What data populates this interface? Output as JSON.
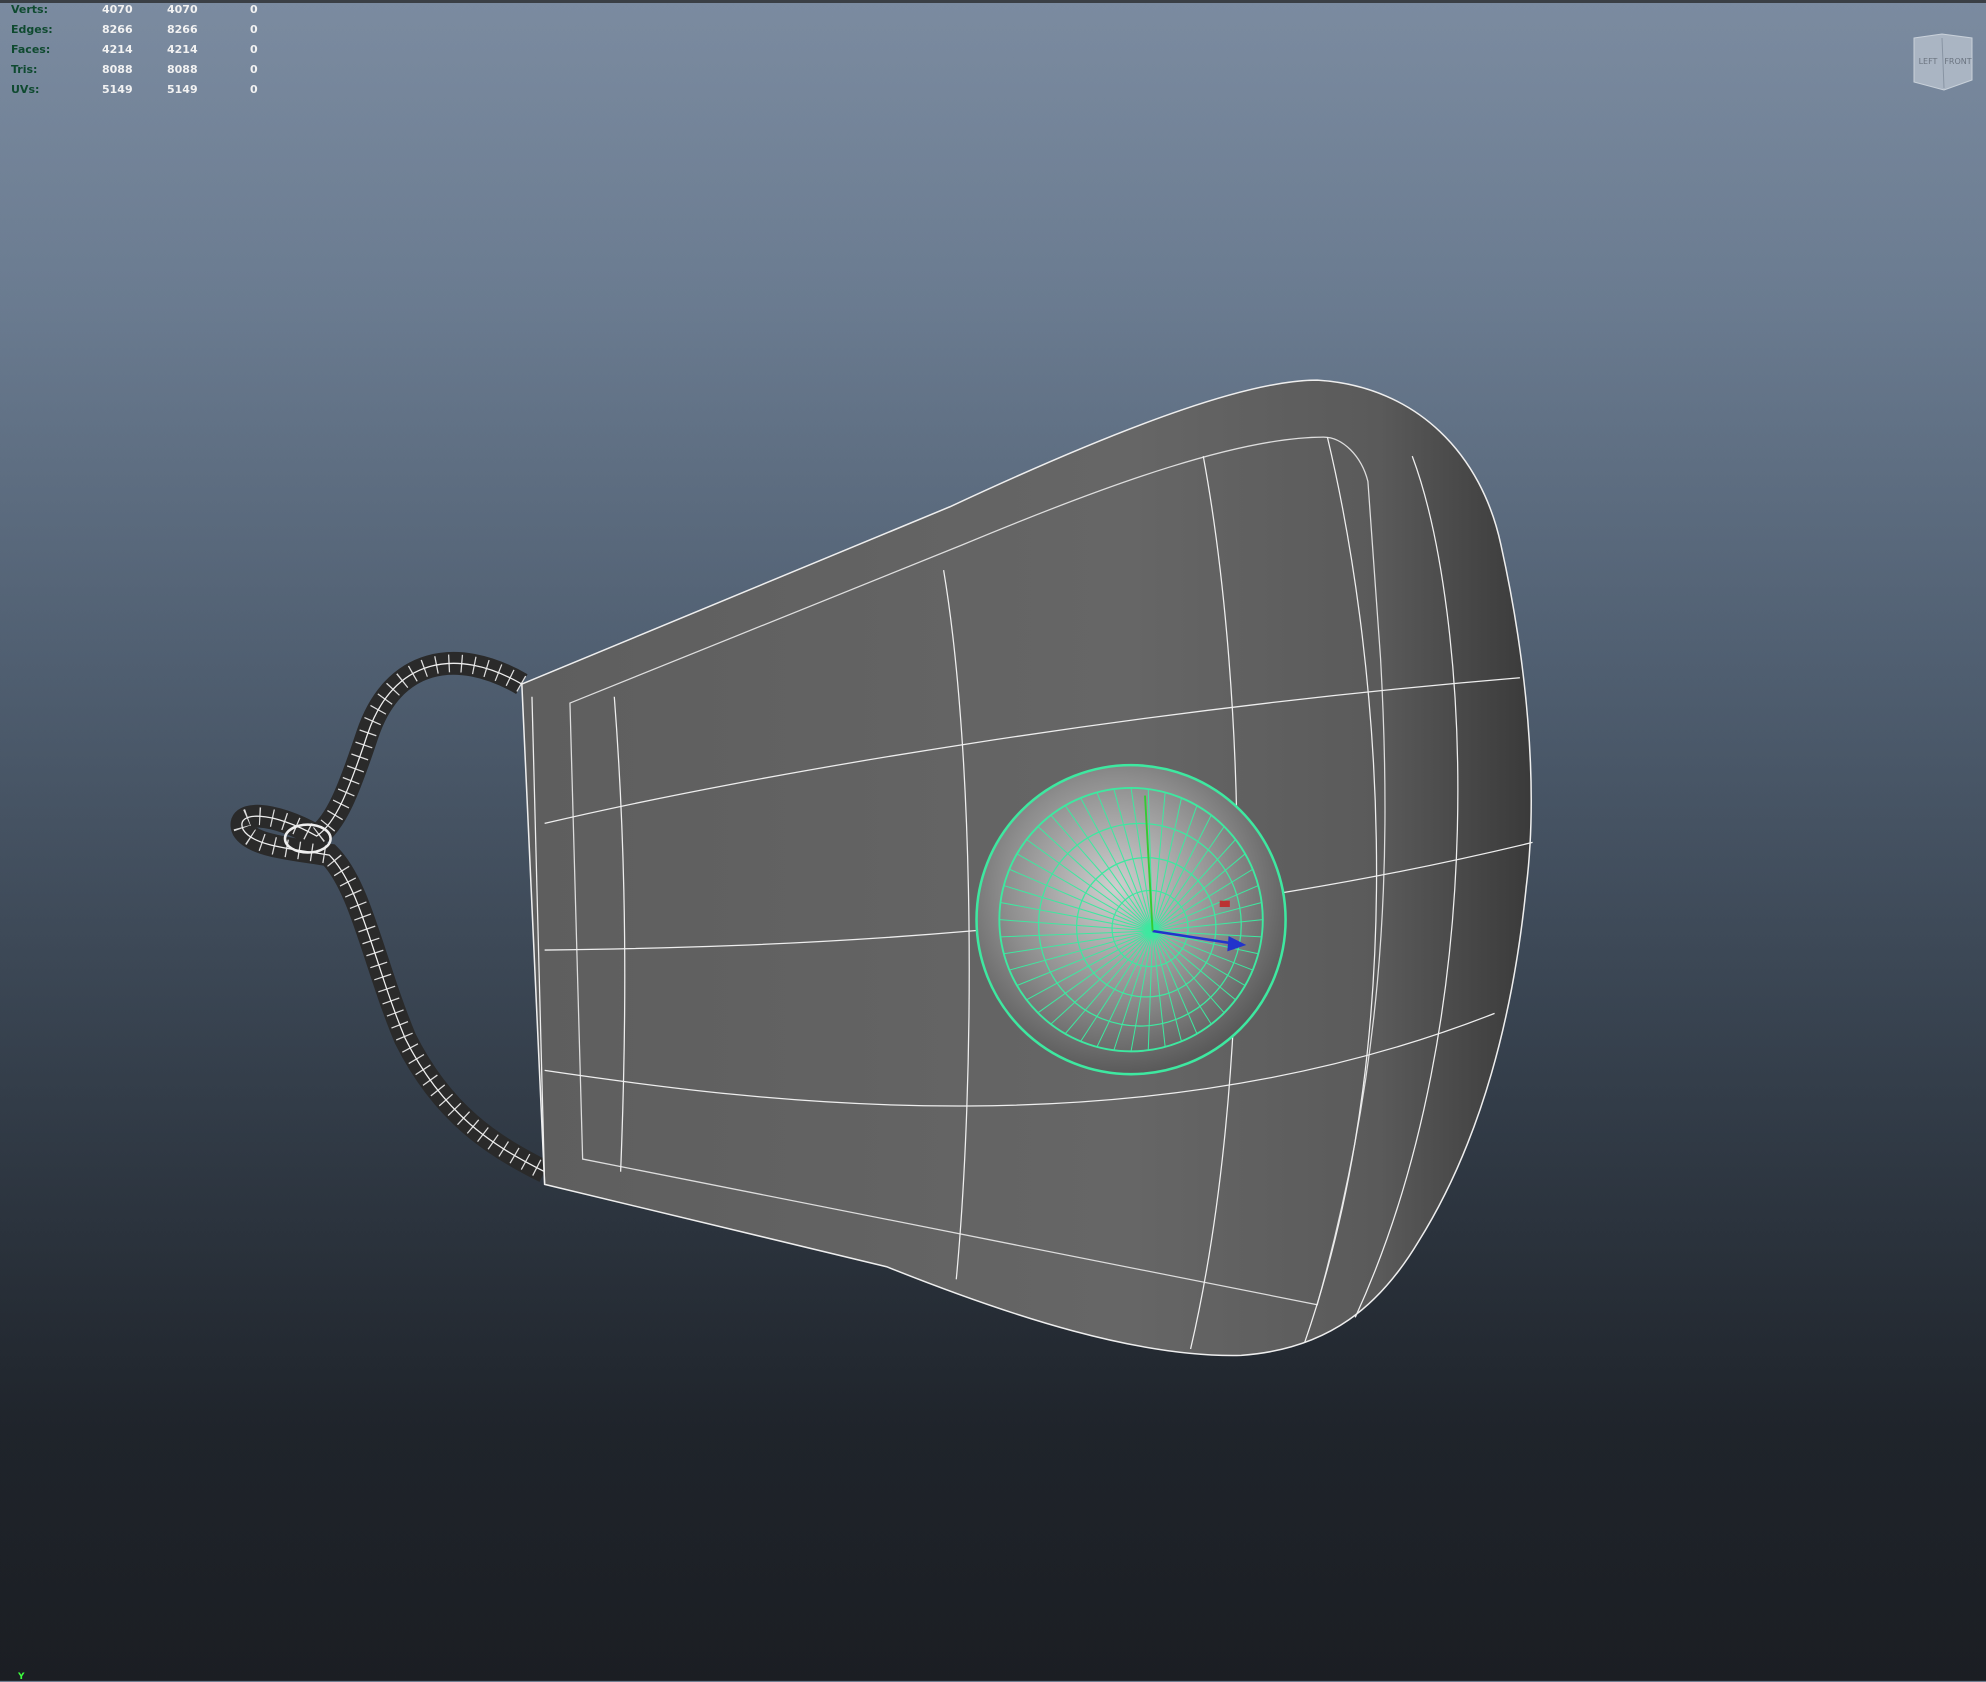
{
  "viewport": {
    "stats": [
      {
        "label": "Verts:",
        "values": [
          "4070",
          "4070",
          "0"
        ]
      },
      {
        "label": "Edges:",
        "values": [
          "8266",
          "8266",
          "0"
        ]
      },
      {
        "label": "Faces:",
        "values": [
          "4214",
          "4214",
          "0"
        ]
      },
      {
        "label": "Tris:",
        "values": [
          "8088",
          "8088",
          "0"
        ]
      },
      {
        "label": "UVs:",
        "values": [
          "5149",
          "5149",
          "0"
        ]
      }
    ],
    "view_cube": {
      "left_label": "LEFT",
      "front_label": "FRONT"
    },
    "axis_indicator": "Y",
    "selection_color": "#3ee8a0"
  }
}
